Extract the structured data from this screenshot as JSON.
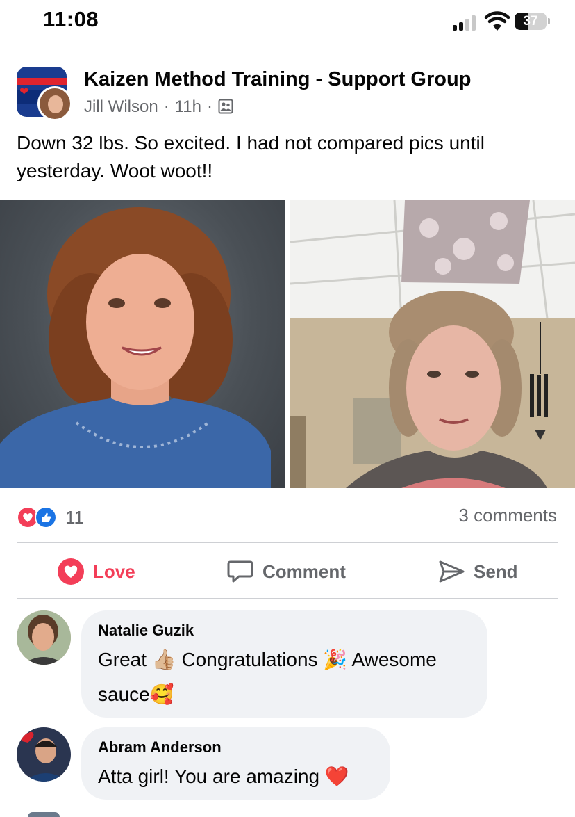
{
  "status_bar": {
    "time": "11:08",
    "battery": "37"
  },
  "post": {
    "group_name": "Kaizen Method Training - Support Group",
    "author": "Jill Wilson",
    "time": "11h",
    "separator": "·",
    "text": "Down 32 lbs. So excited. I had not compared pics until yesterday. Woot woot!!",
    "reaction_count": "11",
    "comments_count": "3 comments"
  },
  "actions": {
    "love": "Love",
    "comment": "Comment",
    "send": "Send"
  },
  "comments": [
    {
      "author": "Natalie Guzik",
      "line1": "Great 👍🏼 Congratulations 🎉 Awesome",
      "line2": "sauce🥰"
    },
    {
      "author": "Abram Anderson",
      "text": "Atta girl! You are amazing ❤️"
    }
  ],
  "colors": {
    "love": "#f33e58",
    "like": "#1b74e4",
    "secondary_text": "#65676b",
    "bubble": "#f0f2f5"
  }
}
